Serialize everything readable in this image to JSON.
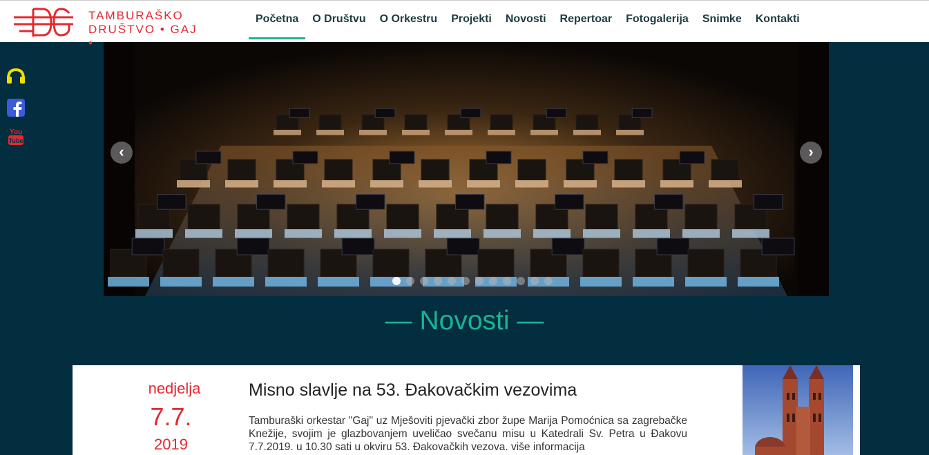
{
  "logo": {
    "line1": "TAMBURAŠKO",
    "line2": "DRUŠTVO • GAJ •",
    "monogram": "DG"
  },
  "nav": [
    {
      "label": "Početna",
      "active": true
    },
    {
      "label": "O Društvu"
    },
    {
      "label": "O Orkestru"
    },
    {
      "label": "Projekti"
    },
    {
      "label": "Novosti"
    },
    {
      "label": "Repertoar"
    },
    {
      "label": "Fotogalerija"
    },
    {
      "label": "Snimke"
    },
    {
      "label": "Kontakti"
    }
  ],
  "social": {
    "youtube_line1": "You",
    "youtube_line2": "Tube"
  },
  "slider": {
    "prev": "‹",
    "next": "›",
    "dot_count": 12,
    "active_dot": 0
  },
  "section_title": "— Novosti —",
  "news": {
    "day": "nedjelja",
    "date": "7.7.",
    "year": "2019",
    "title": "Misno slavlje na 53. Đakovačkim vezovima",
    "text": "Tamburaški orkestar \"Gaj\" uz Mješoviti pjevački zbor župe Marija Pomoćnica sa zagrebačke Knežije, svojim je glazbovanjem uveličao svečanu misu u Katedrali Sv. Petra u Đakovu 7.7.2019. u 10.30 sati u okviru 53. Đakovačkih vezova. više informacija"
  },
  "colors": {
    "accent": "#1ab394",
    "brand_red": "#e5282f",
    "background": "#022e40"
  }
}
